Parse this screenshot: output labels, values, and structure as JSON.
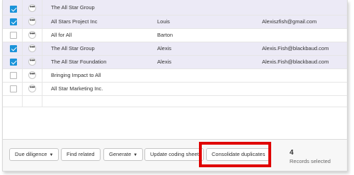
{
  "rows": [
    {
      "checked": true,
      "name": "The All Star Group",
      "first": "",
      "email": ""
    },
    {
      "checked": true,
      "name": "All Stars Project Inc",
      "first": "Louis",
      "email": "Alexiszfish@gmail.com"
    },
    {
      "checked": false,
      "name": "All for All",
      "first": "Barton",
      "email": ""
    },
    {
      "checked": true,
      "name": "The All Star Group",
      "first": "Alexis",
      "email": "Alexis.Fish@blackbaud.com"
    },
    {
      "checked": true,
      "name": "The All Star Foundation",
      "first": "Alexis",
      "email": "Alexis.Fish@blackbaud.com"
    },
    {
      "checked": false,
      "name": "Bringing Impact to All",
      "first": "",
      "email": ""
    },
    {
      "checked": false,
      "name": "All Star Marketing Inc.",
      "first": "",
      "email": ""
    }
  ],
  "more_glyph": "•••",
  "toolbar": {
    "due_diligence": "Due diligence",
    "find_related": "Find related",
    "generate": "Generate",
    "update_coding": "Update coding sheet",
    "consolidate": "Consolidate duplicates",
    "caret": "▼"
  },
  "selection": {
    "count": "4",
    "label": "Records selected"
  },
  "colors": {
    "selected_row": "#eceaf6",
    "checkbox_accent": "#1a93d9",
    "highlight_box": "#e00000"
  }
}
